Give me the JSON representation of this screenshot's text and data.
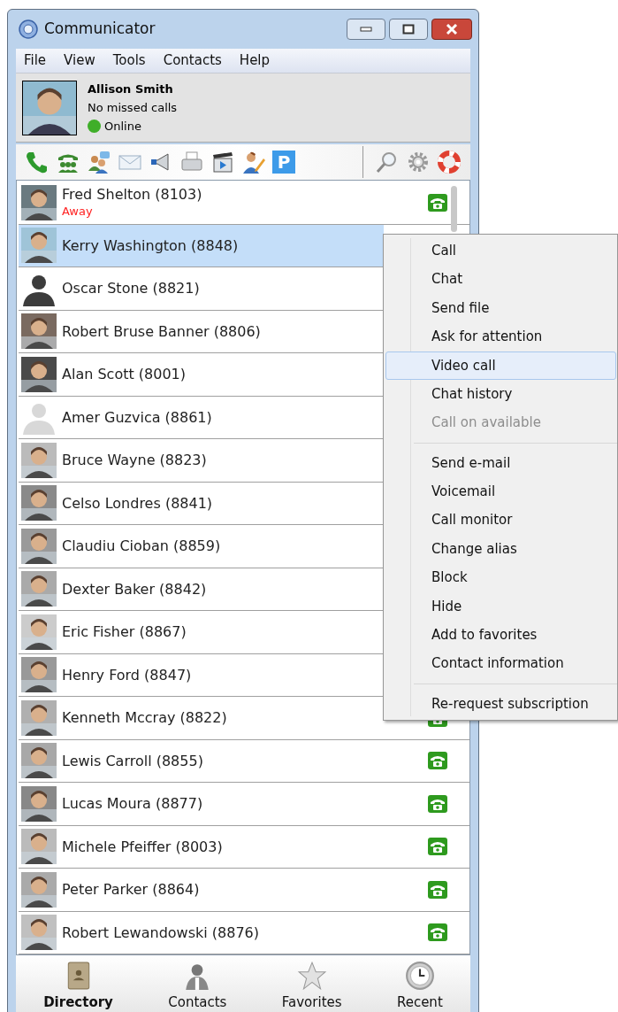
{
  "window": {
    "title": "Communicator"
  },
  "menu_bar": [
    "File",
    "View",
    "Tools",
    "Contacts",
    "Help"
  ],
  "profile": {
    "name": "Allison Smith",
    "missed_calls": "No missed calls",
    "presence": "Online",
    "color": "#3fae29"
  },
  "toolbar": {
    "parking_label": "P"
  },
  "contacts": [
    {
      "name": "Fred Shelton (8103)",
      "status": "Away",
      "selected": false,
      "call_button": true
    },
    {
      "name": "Kerry Washington (8848)",
      "selected": true,
      "call_button": false
    },
    {
      "name": "Oscar Stone (8821)",
      "kind": "silhouette",
      "selected": false,
      "call_button": false
    },
    {
      "name": "Robert Bruse Banner (8806)",
      "selected": false,
      "call_button": false
    },
    {
      "name": "Alan Scott (8001)",
      "selected": false,
      "call_button": false
    },
    {
      "name": "Amer Guzvica (8861)",
      "kind": "blank",
      "selected": false,
      "call_button": false
    },
    {
      "name": "Bruce Wayne (8823)",
      "selected": false,
      "call_button": false
    },
    {
      "name": "Celso Londres (8841)",
      "selected": false,
      "call_button": false
    },
    {
      "name": "Claudiu Cioban (8859)",
      "selected": false,
      "call_button": false
    },
    {
      "name": "Dexter Baker (8842)",
      "selected": false,
      "call_button": false
    },
    {
      "name": "Eric Fisher (8867)",
      "selected": false,
      "call_button": false
    },
    {
      "name": "Henry Ford (8847)",
      "selected": false,
      "call_button": false
    },
    {
      "name": "Kenneth Mccray (8822)",
      "selected": false,
      "call_button": true
    },
    {
      "name": "Lewis Carroll (8855)",
      "selected": false,
      "call_button": true
    },
    {
      "name": "Lucas Moura (8877)",
      "selected": false,
      "call_button": true
    },
    {
      "name": "Michele Pfeiffer (8003)",
      "selected": false,
      "call_button": true
    },
    {
      "name": "Peter Parker (8864)",
      "selected": false,
      "call_button": true
    },
    {
      "name": "Robert Lewandowski (8876)",
      "selected": false,
      "call_button": true
    }
  ],
  "context_menu": {
    "groups": [
      [
        {
          "label": "Call",
          "disabled": false,
          "selected": false
        },
        {
          "label": "Chat",
          "disabled": false,
          "selected": false
        },
        {
          "label": "Send file",
          "disabled": false,
          "selected": false
        },
        {
          "label": "Ask for attention",
          "disabled": false,
          "selected": false
        },
        {
          "label": "Video call",
          "disabled": false,
          "selected": true
        },
        {
          "label": "Chat history",
          "disabled": false,
          "selected": false
        },
        {
          "label": "Call on available",
          "disabled": true,
          "selected": false
        }
      ],
      [
        {
          "label": "Send e-mail",
          "disabled": false,
          "selected": false
        },
        {
          "label": "Voicemail",
          "disabled": false,
          "selected": false
        },
        {
          "label": "Call monitor",
          "disabled": false,
          "selected": false
        },
        {
          "label": "Change alias",
          "disabled": false,
          "selected": false
        },
        {
          "label": "Block",
          "disabled": false,
          "selected": false
        },
        {
          "label": "Hide",
          "disabled": false,
          "selected": false
        },
        {
          "label": "Add to favorites",
          "disabled": false,
          "selected": false
        },
        {
          "label": "Contact information",
          "disabled": false,
          "selected": false
        }
      ],
      [
        {
          "label": "Re-request subscription",
          "disabled": false,
          "selected": false
        }
      ]
    ]
  },
  "bottom_tabs": [
    {
      "label": "Directory",
      "kind": "directory",
      "selected": true
    },
    {
      "label": "Contacts",
      "kind": "contacts",
      "selected": false
    },
    {
      "label": "Favorites",
      "kind": "favorites",
      "selected": false
    },
    {
      "label": "Recent",
      "kind": "recent",
      "selected": false
    }
  ]
}
